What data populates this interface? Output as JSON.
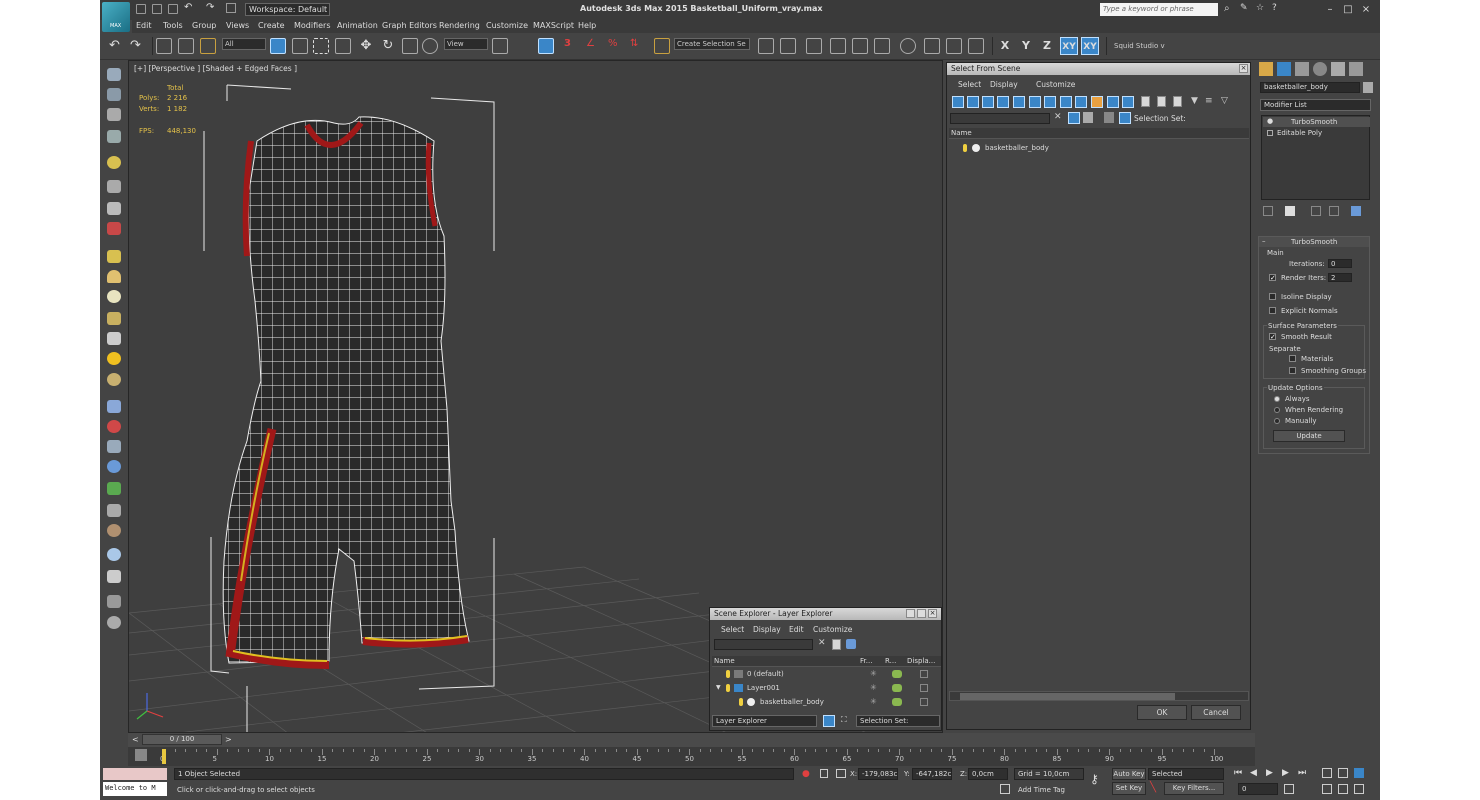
{
  "app": {
    "logo_text": "MAX",
    "title": "Autodesk 3ds Max  2015     Basketball_Uniform_vray.max",
    "workspace": "Workspace: Default",
    "search_placeholder": "Type a keyword or phrase"
  },
  "menu": [
    "Edit",
    "Tools",
    "Group",
    "Views",
    "Create",
    "Modifiers",
    "Animation",
    "Graph Editors",
    "Rendering",
    "Customize",
    "MAXScript",
    "Help"
  ],
  "toolbar": {
    "filter_dropdown": "All",
    "ref_coord": "View",
    "selection_set": "Create Selection Se",
    "axes": [
      "X",
      "Y",
      "Z",
      "XY",
      "XY"
    ],
    "studio_label": "Squid Studio v"
  },
  "viewport": {
    "label": "[+] [Perspective ] [Shaded + Edged Faces ]",
    "stats_header": "Total",
    "polys_label": "Polys:",
    "polys_value": "2 216",
    "verts_label": "Verts:",
    "verts_value": "1 182",
    "fps_label": "FPS:",
    "fps_value": "448,130"
  },
  "select_from_scene": {
    "title": "Select From Scene",
    "menu": [
      "Select",
      "Display",
      "Customize"
    ],
    "selection_set_label": "Selection Set:",
    "column_name": "Name",
    "items": [
      "basketballer_body"
    ],
    "ok_label": "OK",
    "cancel_label": "Cancel"
  },
  "scene_explorer": {
    "title": "Scene Explorer - Layer Explorer",
    "menu": [
      "Select",
      "Display",
      "Edit",
      "Customize"
    ],
    "columns": [
      "Name",
      "Fr...",
      "R...",
      "Displa..."
    ],
    "rows": [
      {
        "name": "0 (default)"
      },
      {
        "name": "Layer001"
      },
      {
        "name": "basketballer_body"
      }
    ],
    "explorer_dropdown": "Layer Explorer",
    "selection_set_label": "Selection Set:"
  },
  "command_panel": {
    "object_name": "basketballer_body",
    "modifier_list": "Modifier List",
    "stack": [
      "TurboSmooth",
      "Editable Poly"
    ],
    "rollout_title": "TurboSmooth",
    "main_label": "Main",
    "iterations_label": "Iterations:",
    "iterations_value": "0",
    "render_iters_label": "Render Iters:",
    "render_iters_value": "2",
    "isoline_label": "Isoline Display",
    "explicit_normals_label": "Explicit Normals",
    "surface_params_label": "Surface Parameters",
    "smooth_result_label": "Smooth Result",
    "separate_label": "Separate",
    "materials_label": "Materials",
    "smoothing_groups_label": "Smoothing Groups",
    "update_options_label": "Update Options",
    "always_label": "Always",
    "when_rendering_label": "When Rendering",
    "manually_label": "Manually",
    "update_button": "Update"
  },
  "timeline": {
    "frame_display": "0 / 100",
    "prev_arrow": "<",
    "next_arrow": ">",
    "ticks": [
      "0",
      "5",
      "10",
      "15",
      "20",
      "25",
      "30",
      "35",
      "40",
      "45",
      "50",
      "55",
      "60",
      "65",
      "70",
      "75",
      "80",
      "85",
      "90",
      "95",
      "100"
    ]
  },
  "status": {
    "maxscript_listener": "Welcome to M",
    "objects_selected": "1 Object Selected",
    "prompt": "Click or click-and-drag to select objects",
    "x_label": "X:",
    "x_value": "-179,083cr",
    "y_label": "Y:",
    "y_value": "-647,182cr",
    "z_label": "Z:",
    "z_value": "0,0cm",
    "grid": "Grid = 10,0cm",
    "add_time_tag": "Add Time Tag",
    "auto_key": "Auto Key",
    "selected_dropdown": "Selected",
    "set_key": "Set Key",
    "key_filters": "Key Filters...",
    "frame_value": "0"
  },
  "colors": {
    "ui_bg": "#444444",
    "viewport_bg": "#3f3f3f",
    "accent_blue": "#3a86c8",
    "stats_yellow": "#e4c24a",
    "uniform_red": "#a01818"
  }
}
